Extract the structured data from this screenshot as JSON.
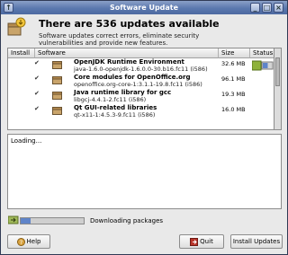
{
  "window": {
    "title": "Software Update",
    "titlebar_left_button": "↑",
    "titlebar_min": "_",
    "titlebar_max": "□",
    "titlebar_close": "×"
  },
  "header": {
    "title": "There are 536 updates available",
    "description": "Software updates correct errors, eliminate security vulnerabilities and provide new features."
  },
  "table": {
    "columns": {
      "install": "Install",
      "software": "Software",
      "size": "Size",
      "status": "Status",
      "status_arrow": "∨"
    },
    "rows": [
      {
        "checked": true,
        "name": "OpenJDK Runtime Environment",
        "version": "java-1.6.0-openjdk-1.6.0.0-30.b16.fc11 (i586)",
        "size": "32.6 MB"
      },
      {
        "checked": true,
        "name": "Core modules for OpenOffice.org",
        "version": "openoffice.org-core-1:3.1.1-19.8.fc11 (i586)",
        "size": "96.1 MB"
      },
      {
        "checked": true,
        "name": "Java runtime library for gcc",
        "version": "libgcj-4.4.1-2.fc11 (i586)",
        "size": "19.3 MB"
      },
      {
        "checked": true,
        "name": "Qt GUI-related libraries",
        "version": "qt-x11-1:4.5.3-9.fc11 (i586)",
        "size": "16.0 MB"
      }
    ],
    "check_glyph": "✔",
    "status_progress": 0.55
  },
  "log": {
    "text": "Loading..."
  },
  "progress": {
    "label": "Downloading packages",
    "fraction": 0.15
  },
  "buttons": {
    "help": "Help",
    "quit": "Quit",
    "install": "Install Updates"
  },
  "colors": {
    "titlebar": "#5b78ae",
    "accent": "#5f84c9"
  },
  "icons": {
    "header": "software-update-icon",
    "package": "package-icon",
    "status": "download-status-icon",
    "progress": "download-arrow-icon",
    "help": "help-icon",
    "quit": "quit-icon"
  }
}
